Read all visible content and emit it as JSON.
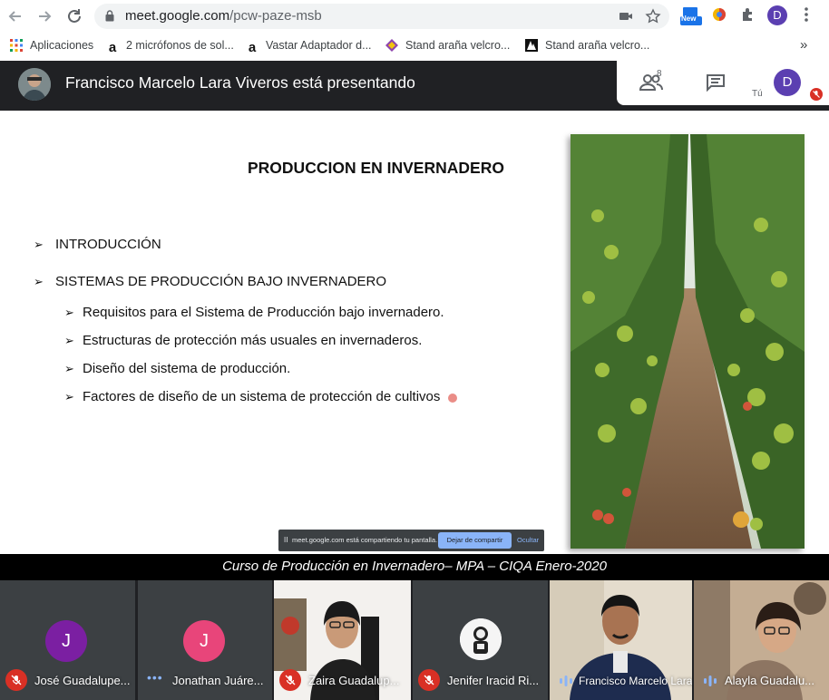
{
  "browser": {
    "url_host": "meet.google.com",
    "url_path": "/pcw-paze-msb",
    "profile_initial": "D",
    "new_badge": "New",
    "bookmarks": [
      {
        "label": "Aplicaciones",
        "icon": "apps-grid-icon"
      },
      {
        "label": "2 micrófonos de sol...",
        "icon": "amazon-icon"
      },
      {
        "label": "Vastar Adaptador d...",
        "icon": "amazon-icon"
      },
      {
        "label": "Stand araña velcro...",
        "icon": "logo-icon"
      },
      {
        "label": "Stand araña velcro...",
        "icon": "logo-icon"
      }
    ],
    "more_bookmarks": "»"
  },
  "meet": {
    "presenter_title": "Francisco Marcelo Lara Viveros está presentando",
    "people_count": "8",
    "self_initial": "D",
    "self_label": "Tú"
  },
  "slide": {
    "title": "PRODUCCION EN INVERNADERO",
    "bullets": [
      {
        "text": "INTRODUCCIÓN",
        "level": 1
      },
      {
        "text": "SISTEMAS DE PRODUCCIÓN BAJO INVERNADERO",
        "level": 1
      },
      {
        "text": "Requisitos para el Sistema de Producción bajo invernadero.",
        "level": 2
      },
      {
        "text": "Estructuras de protección más usuales en invernaderos.",
        "level": 2
      },
      {
        "text": "Diseño del sistema de producción.",
        "level": 2
      },
      {
        "text": "Factores de diseño de un sistema de protección de cultivos",
        "level": 2
      }
    ],
    "bullet_glyph": "➢"
  },
  "share_banner": {
    "pause_glyph": "II",
    "message": "meet.google.com está compartiendo tu pantalla.",
    "stop_label": "Dejar de compartir",
    "hide_label": "Ocultar"
  },
  "caption": "Curso de Producción en Invernadero– MPA – CIQA Enero-2020",
  "participants": [
    {
      "name": "José Guadalupe...",
      "initial": "J",
      "avatar_color": "#7b1fa2",
      "status": "muted"
    },
    {
      "name": "Jonathan Juáre...",
      "initial": "J",
      "avatar_color": "#e8457a",
      "status": "dots"
    },
    {
      "name": "Zaira Guadalup...",
      "initial": "",
      "avatar_color": "",
      "status": "muted"
    },
    {
      "name": "Jenifer Iracid Ri...",
      "initial": "",
      "avatar_color": "",
      "status": "muted"
    },
    {
      "name": "Francisco Marcelo Lara...",
      "initial": "",
      "avatar_color": "",
      "status": "speaking"
    },
    {
      "name": "Alayla Guadalu...",
      "initial": "",
      "avatar_color": "",
      "status": "speaking"
    }
  ],
  "colors": {
    "meet_dark": "#202124",
    "mute_red": "#d93025",
    "accent_blue": "#8ab4f8"
  }
}
